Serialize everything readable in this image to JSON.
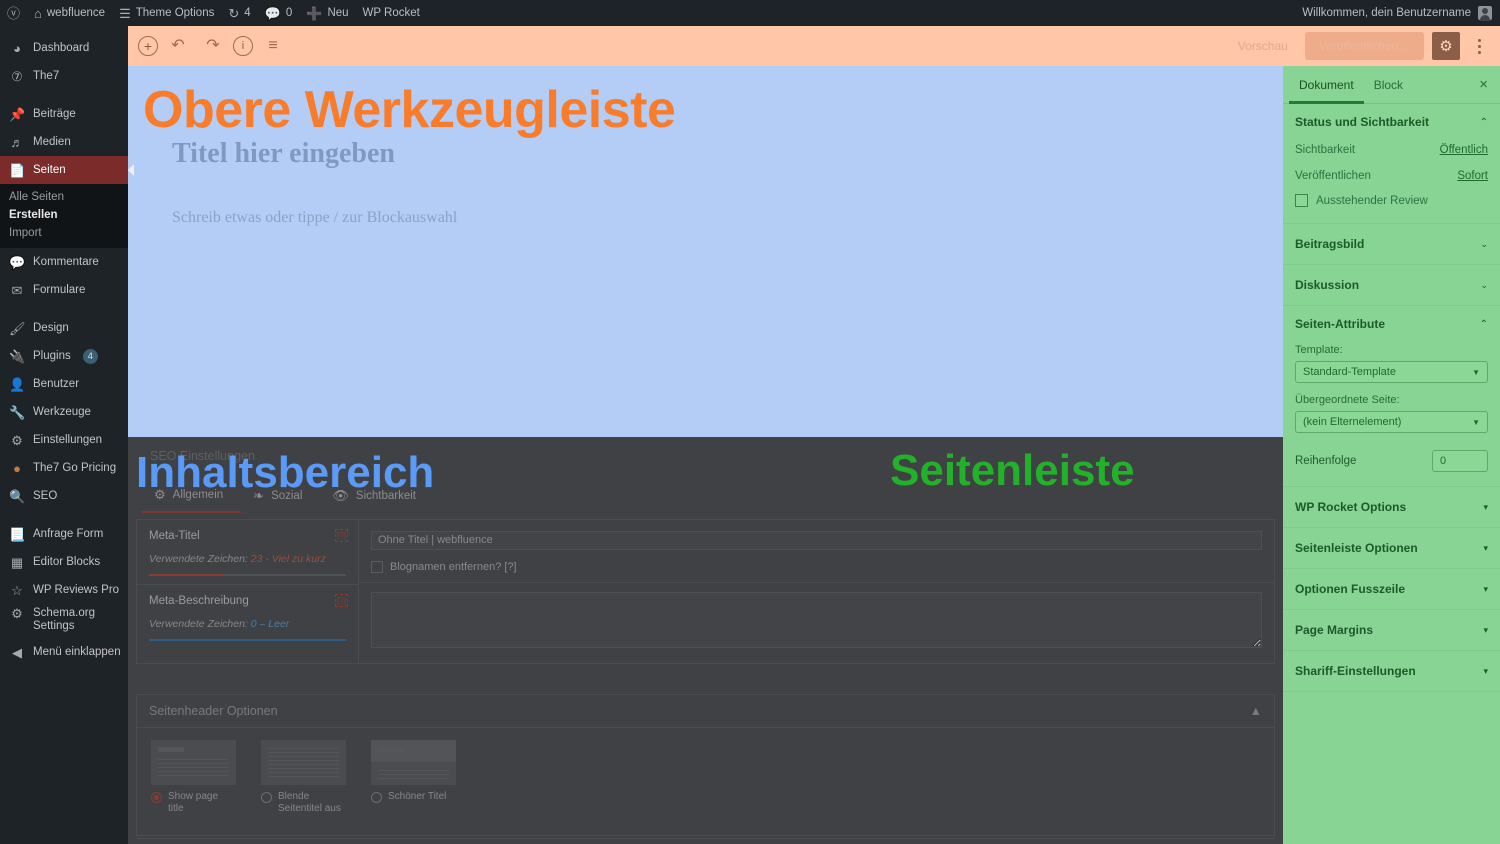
{
  "adminbar": {
    "logo_icon": "wordpress-icon",
    "items": [
      {
        "icon": "home-icon",
        "label": "webfluence"
      },
      {
        "icon": "sliders-icon",
        "label": "Theme Options"
      },
      {
        "icon": "updates-icon",
        "label": "4"
      },
      {
        "icon": "comment-icon",
        "label": "0"
      },
      {
        "icon": "plus-icon",
        "label": "Neu"
      },
      {
        "icon": "",
        "label": "WP Rocket"
      }
    ],
    "greeting": "Willkommen, dein Benutzername"
  },
  "adminmenu": {
    "items": [
      {
        "icon": "dashboard-icon",
        "label": "Dashboard",
        "name": "dashboard"
      },
      {
        "icon": "the7-icon",
        "label": "The7",
        "name": "the7"
      },
      {
        "sep": true
      },
      {
        "icon": "pin-icon",
        "label": "Beiträge",
        "name": "beitraege"
      },
      {
        "icon": "media-icon",
        "label": "Medien",
        "name": "medien"
      },
      {
        "icon": "pages-icon",
        "label": "Seiten",
        "name": "seiten",
        "current": true
      },
      {
        "submenu": [
          "Alle Seiten",
          "Erstellen",
          "Import"
        ],
        "active_index": 1
      },
      {
        "icon": "comment-icon",
        "label": "Kommentare",
        "name": "kommentare"
      },
      {
        "icon": "mail-icon",
        "label": "Formulare",
        "name": "formulare"
      },
      {
        "sep": true
      },
      {
        "icon": "brush-icon",
        "label": "Design",
        "name": "design"
      },
      {
        "icon": "plug-icon",
        "label": "Plugins",
        "name": "plugins",
        "badge": "4"
      },
      {
        "icon": "user-icon",
        "label": "Benutzer",
        "name": "benutzer"
      },
      {
        "icon": "wrench-icon",
        "label": "Werkzeuge",
        "name": "werkzeuge"
      },
      {
        "icon": "settings-icon",
        "label": "Einstellungen",
        "name": "einstellungen"
      },
      {
        "icon": "dot-icon",
        "label": "The7 Go Pricing",
        "name": "the7-go-pricing"
      },
      {
        "icon": "search-icon",
        "label": "SEO",
        "name": "seo"
      },
      {
        "sep": true
      },
      {
        "icon": "form-icon",
        "label": "Anfrage Form",
        "name": "anfrage-form"
      },
      {
        "icon": "grid-icon",
        "label": "Editor Blocks",
        "name": "editor-blocks"
      },
      {
        "icon": "star-icon",
        "label": "WP Reviews Pro",
        "name": "wp-reviews-pro"
      },
      {
        "icon": "gear-icon",
        "label": "Schema.org Settings",
        "name": "schema-org-settings",
        "twoline": true
      },
      {
        "icon": "collapse-icon",
        "label": "Menü einklappen",
        "name": "menu-einklappen"
      }
    ]
  },
  "editor_toolbar": {
    "icons": [
      {
        "name": "add-block-icon",
        "glyph": "+"
      },
      {
        "name": "undo-icon",
        "glyph": "↺"
      },
      {
        "name": "redo-icon",
        "glyph": "↻"
      },
      {
        "name": "info-icon",
        "glyph": "i"
      },
      {
        "name": "list-view-icon",
        "glyph": "≡"
      }
    ],
    "preview_label": "Vorschau",
    "publish_label": "Veröffentlichen…",
    "gear_icon": "gear-icon",
    "more_icon": "kebab-menu-icon"
  },
  "canvas": {
    "title_placeholder": "Titel hier eingeben",
    "paragraph_placeholder": "Schreib etwas oder tippe / zur Blockauswahl"
  },
  "overlays": {
    "toolbar_label": "Obere Werkzeugleiste",
    "content_label": "Inhaltsbereich",
    "sidebar_label": "Seitenleiste",
    "toolbar_color": "#f97c2b",
    "content_color": "#5b9bf8",
    "sidebar_color": "#22b22a"
  },
  "seo_box": {
    "title": "SEO Einstellungen",
    "tabs": [
      {
        "icon": "gear-icon",
        "label": "Allgemein",
        "active": true
      },
      {
        "icon": "share-icon",
        "label": "Sozial",
        "active": false
      },
      {
        "icon": "eye-icon",
        "label": "Sichtbarkeit",
        "active": false
      }
    ],
    "meta_title": {
      "label": "Meta-Titel",
      "help": "[?]",
      "count_prefix": "Verwendete Zeichen:",
      "count_value": "23 - Viel zu kurz",
      "count_color": "#9f4b3f",
      "bar_width": "38%",
      "bar_color": "#8a3b31",
      "input_value": "Ohne Titel | webfluence",
      "checkbox_label": "Blognamen entfernen? [?]",
      "checkbox_checked": false
    },
    "meta_description": {
      "label": "Meta-Beschreibung",
      "help": "[?]",
      "count_prefix": "Verwendete Zeichen:",
      "count_value": "0 – Leer",
      "count_color": "#4a7ea8",
      "bar_width": "100%",
      "bar_color": "#2a5e85",
      "textarea_value": ""
    }
  },
  "page_header_box": {
    "title": "Seitenheader Optionen",
    "caret": "▲",
    "options": [
      {
        "label": "Show page title",
        "selected": true,
        "thumb": "title-and-text"
      },
      {
        "label": "Blende Seitentitel aus",
        "selected": false,
        "thumb": "text-only"
      },
      {
        "label": "Schöner Titel",
        "selected": false,
        "thumb": "banner-title"
      }
    ]
  },
  "sidebar": {
    "tabs": [
      {
        "label": "Dokument",
        "active": true
      },
      {
        "label": "Block",
        "active": false
      }
    ],
    "close_icon": "close-icon",
    "panels": [
      {
        "title": "Status und Sichtbarkeit",
        "expanded": true,
        "chevron": "⌃",
        "rows": [
          {
            "key": "Sichtbarkeit",
            "value": "Öffentlich"
          },
          {
            "key": "Veröffentlichen",
            "value": "Sofort"
          }
        ],
        "checkbox": {
          "label": "Ausstehender Review",
          "checked": false
        }
      },
      {
        "title": "Beitragsbild",
        "expanded": false,
        "chevron": "⌄"
      },
      {
        "title": "Diskussion",
        "expanded": false,
        "chevron": "⌄"
      },
      {
        "title": "Seiten-Attribute",
        "expanded": true,
        "chevron": "⌃",
        "fields": [
          {
            "label": "Template:",
            "type": "select",
            "value": "Standard-Template"
          },
          {
            "label": "Übergeordnete Seite:",
            "type": "select",
            "value": "(kein Elternelement)"
          },
          {
            "label": "Reihenfolge",
            "type": "number",
            "value": "0"
          }
        ]
      },
      {
        "title": "WP Rocket Options",
        "expanded": false,
        "chevron": "▾"
      },
      {
        "title": "Seitenleiste Optionen",
        "expanded": false,
        "chevron": "▾"
      },
      {
        "title": "Optionen Fusszeile",
        "expanded": false,
        "chevron": "▾"
      },
      {
        "title": "Page Margins",
        "expanded": false,
        "chevron": "▾"
      },
      {
        "title": "Shariff-Einstellungen",
        "expanded": false,
        "chevron": "▾"
      }
    ]
  }
}
